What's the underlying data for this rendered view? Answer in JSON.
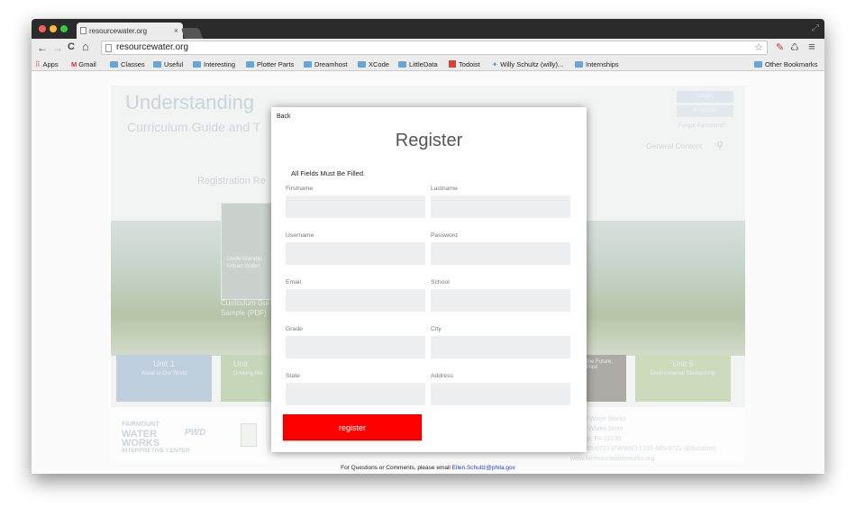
{
  "browser": {
    "tab_title": "resourcewater.org",
    "tab_close": "×",
    "url": "resourcewater.org",
    "nav": {
      "back": "←",
      "forward": "→",
      "reload": "C",
      "home": "⌂"
    },
    "menu_glyph": "≡",
    "bookmarks": [
      "Apps",
      "Gmail",
      "Classes",
      "Useful",
      "Interesting",
      "Plotter Parts",
      "Dreamhost",
      "XCode",
      "LittleData",
      "Todoist",
      "Willy Schultz (willy)...",
      "Internships"
    ],
    "other_bookmarks": "Other Bookmarks"
  },
  "site": {
    "title_line1": "Understanding",
    "title_line2": "Curriculum Guide and T",
    "registration_label": "Registration Re",
    "login": "Login",
    "register": "Register",
    "forgot": "Forgot Password?",
    "general_content": "General Content",
    "book_text": "Understandin\nUrban Water",
    "book_caption_1": "Curriculum Gui",
    "book_caption_2": "Sample (PDF)",
    "units": [
      {
        "title": "Unit 1",
        "subtitle": "Water in Our World",
        "color": "#b8c9d9"
      },
      {
        "title": "Unit",
        "subtitle": "Drinking Wa",
        "color": "#bfd1b0"
      },
      {
        "title": "",
        "subtitle": "the Future,\nPast",
        "color": "#a39f9a"
      },
      {
        "title": "Unit 6",
        "subtitle": "Environmental Stewardship",
        "color": "#c6d5b3"
      }
    ],
    "footer_logo_1": "FAIRMOUNT",
    "footer_logo_2": "WATER",
    "footer_logo_3": "WORKS",
    "footer_logo_small": "INTERPRETIVE CENTER",
    "pwd_logo": "PWD",
    "address": [
      "mount Water Works",
      "Water Works Drive",
      "delphia, PA 19130",
      "215-685-0723 (FWWIC) | 215-685-0721 (Education)",
      "www.fairmountwaterworks.org"
    ]
  },
  "modal": {
    "back": "Back",
    "title": "Register",
    "notice": "All Fields Must Be Filled.",
    "fields": [
      {
        "label": "Firstname",
        "value": ""
      },
      {
        "label": "Lastname",
        "value": ""
      },
      {
        "label": "Username",
        "value": ""
      },
      {
        "label": "Password",
        "value": ""
      },
      {
        "label": "Email",
        "value": ""
      },
      {
        "label": "School",
        "value": ""
      },
      {
        "label": "Grade",
        "value": ""
      },
      {
        "label": "City",
        "value": ""
      },
      {
        "label": "State",
        "value": ""
      },
      {
        "label": "Address",
        "value": ""
      }
    ],
    "submit": "register",
    "submit_color": "#ff0000"
  },
  "contact": {
    "text": "For Questions or Comments, please email",
    "email": "Ellen.Schultz@phila.gov"
  }
}
